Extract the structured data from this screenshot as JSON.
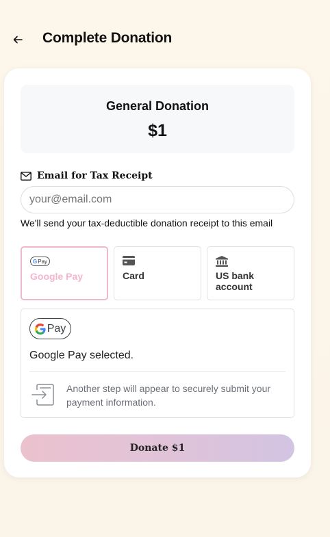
{
  "header": {
    "back_icon": "arrow-left-icon",
    "title": "Complete Donation"
  },
  "summary": {
    "title": "General Donation",
    "amount": "$1"
  },
  "email": {
    "icon": "envelope-icon",
    "label": "Email for Tax Receipt",
    "placeholder": "your@email.com",
    "value": "",
    "help": "We'll send your tax-deductible donation receipt to this email"
  },
  "payment_methods": [
    {
      "label": "Google Pay",
      "icon": "google-pay-icon",
      "selected": true
    },
    {
      "label": "Card",
      "icon": "card-icon",
      "selected": false
    },
    {
      "label": "US bank account",
      "icon": "bank-icon",
      "selected": false
    }
  ],
  "gpay_panel": {
    "badge_text": "Pay",
    "mini_badge_text": "Pay",
    "selected_text": "Google Pay selected.",
    "redirect_icon": "redirect-icon",
    "redirect_text": "Another step will appear to securely submit your payment information."
  },
  "donate_button": {
    "label": "Donate $1"
  },
  "colors": {
    "background": "#fdf6ea",
    "selected_accent": "#f5b5cf",
    "button_gradient_start": "#ebc2ce",
    "button_gradient_end": "#d2c4e2"
  }
}
